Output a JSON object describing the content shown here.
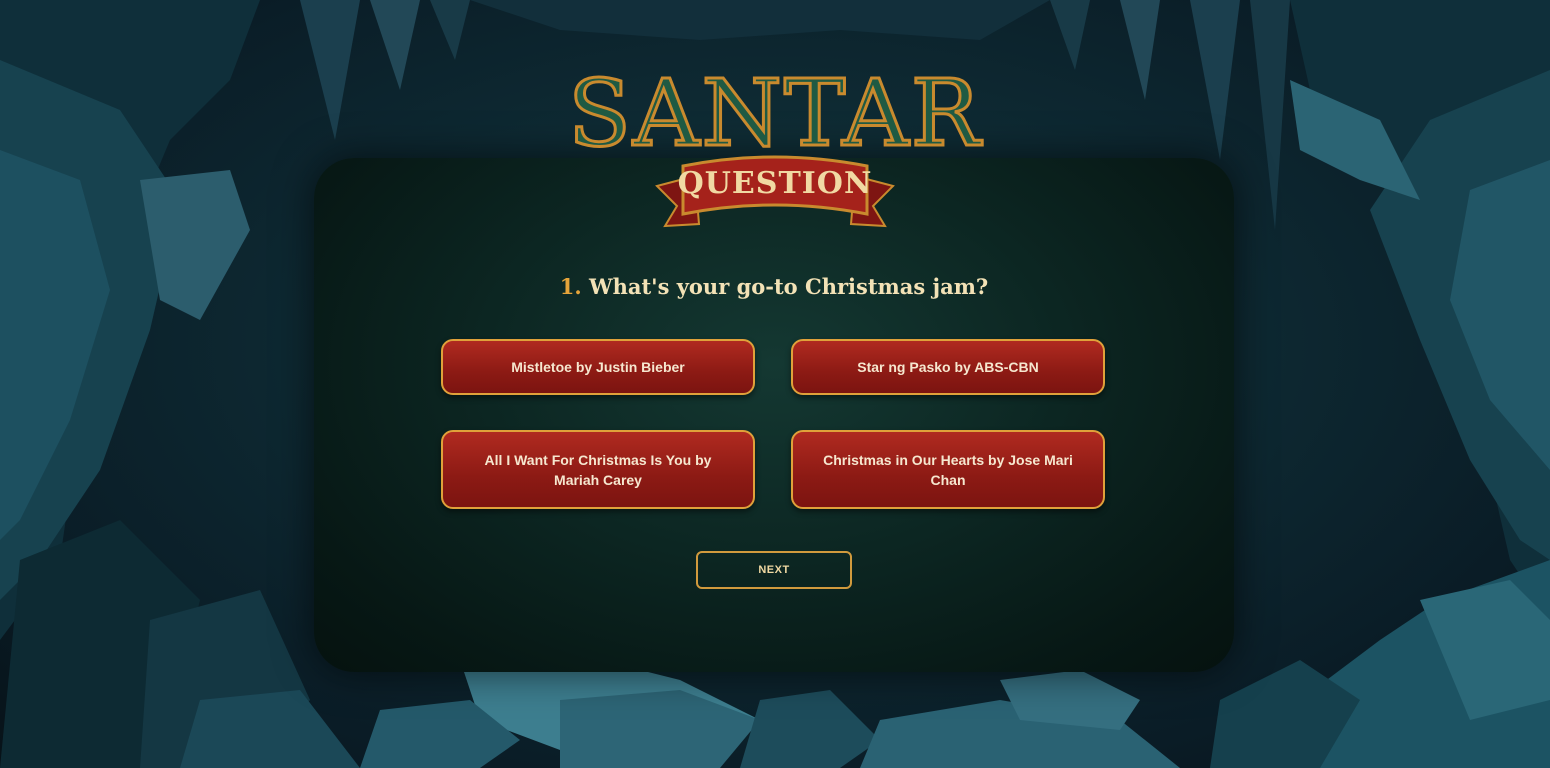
{
  "logo": {
    "title": "SANTAR",
    "banner": "QUESTION"
  },
  "question": {
    "number": "1.",
    "text": "What's your go-to Christmas jam?"
  },
  "answers": [
    {
      "label": "Mistletoe by Justin Bieber"
    },
    {
      "label": "Star ng Pasko by ABS-CBN"
    },
    {
      "label": "All I Want For Christmas Is You by Mariah Carey"
    },
    {
      "label": "Christmas in Our Hearts by Jose Mari Chan"
    }
  ],
  "next_button": {
    "label": "NEXT"
  },
  "colors": {
    "answer_fill": "#9a1f18",
    "answer_border": "#e0a13a",
    "accent_gold": "#e5a43a",
    "question_text": "#f3e2b6",
    "panel": "#0c2622"
  }
}
